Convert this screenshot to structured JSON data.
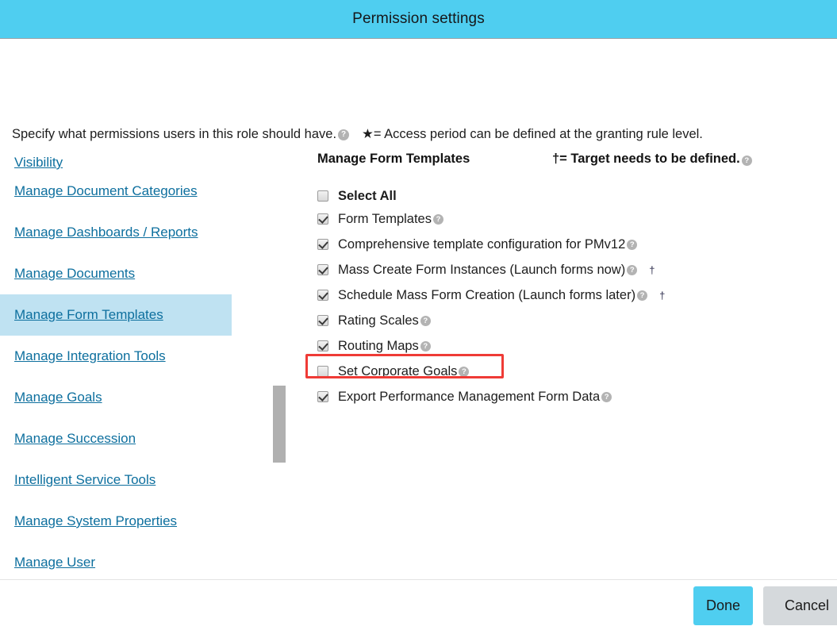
{
  "header": {
    "title": "Permission settings"
  },
  "intro": {
    "text": "Specify what permissions users in this role should have.",
    "help_icon": "help-icon",
    "legend_star": "★= Access period can be defined at the granting rule level."
  },
  "sidebar": {
    "items": [
      {
        "label": "Visibility",
        "selected": false
      },
      {
        "label": "Manage Document Categories",
        "selected": false
      },
      {
        "label": "Manage Dashboards / Reports",
        "selected": false
      },
      {
        "label": "Manage Documents",
        "selected": false
      },
      {
        "label": "Manage Form Templates",
        "selected": true
      },
      {
        "label": "Manage Integration Tools",
        "selected": false
      },
      {
        "label": "Manage Goals",
        "selected": false
      },
      {
        "label": "Manage Succession",
        "selected": false
      },
      {
        "label": "Intelligent Service Tools",
        "selected": false
      },
      {
        "label": "Manage System Properties",
        "selected": false
      },
      {
        "label": "Manage User",
        "selected": false
      }
    ],
    "scrollbar": "vertical-scrollbar"
  },
  "permissions": {
    "group_title": "Manage Form Templates",
    "legend_dagger": "†= Target needs to be defined.",
    "legend_dagger_help_icon": "help-icon",
    "rows": [
      {
        "label": "Select All",
        "checked": false,
        "bold": true,
        "help": false,
        "dagger": ""
      },
      {
        "label": "Form Templates",
        "checked": true,
        "bold": false,
        "help": true,
        "dagger": ""
      },
      {
        "label": "Comprehensive template configuration for PMv12",
        "checked": true,
        "bold": false,
        "help": true,
        "dagger": ""
      },
      {
        "label": "Mass Create Form Instances (Launch forms now)",
        "checked": true,
        "bold": false,
        "help": true,
        "dagger": "†"
      },
      {
        "label": "Schedule Mass Form Creation (Launch forms later)",
        "checked": true,
        "bold": false,
        "help": true,
        "dagger": "†"
      },
      {
        "label": "Rating Scales",
        "checked": true,
        "bold": false,
        "help": true,
        "dagger": ""
      },
      {
        "label": "Routing Maps",
        "checked": true,
        "bold": false,
        "help": true,
        "dagger": ""
      },
      {
        "label": "Set Corporate Goals",
        "checked": false,
        "bold": false,
        "help": true,
        "dagger": "",
        "highlighted": true
      },
      {
        "label": "Export Performance Management Form Data",
        "checked": true,
        "bold": false,
        "help": true,
        "dagger": ""
      }
    ]
  },
  "footer": {
    "done_label": "Done",
    "cancel_label": "Cancel"
  },
  "colors": {
    "header_bg": "#4fcef0",
    "link": "#0d6f9e",
    "selected_nav_bg": "#bfe2f2",
    "annotation": "#ef3b36",
    "done_bg": "#4fcef0",
    "cancel_bg": "#d5d9dc"
  }
}
